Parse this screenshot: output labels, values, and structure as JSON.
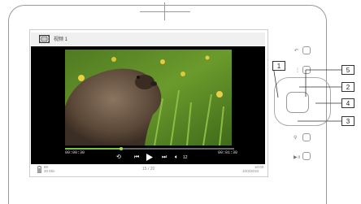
{
  "header": {
    "title": "视频 1"
  },
  "player": {
    "elapsed": "00:00:30",
    "duration": "00:01:30",
    "progress_fraction": 0.33,
    "volume": "12"
  },
  "status": {
    "battery_line1": "80",
    "battery_line2": "30 Min",
    "page": "15 / 20",
    "time": "10:00",
    "date": "10/3/2010"
  },
  "callouts": {
    "c1": "1",
    "c2": "2",
    "c3": "3",
    "c4": "4",
    "c5": "5"
  }
}
